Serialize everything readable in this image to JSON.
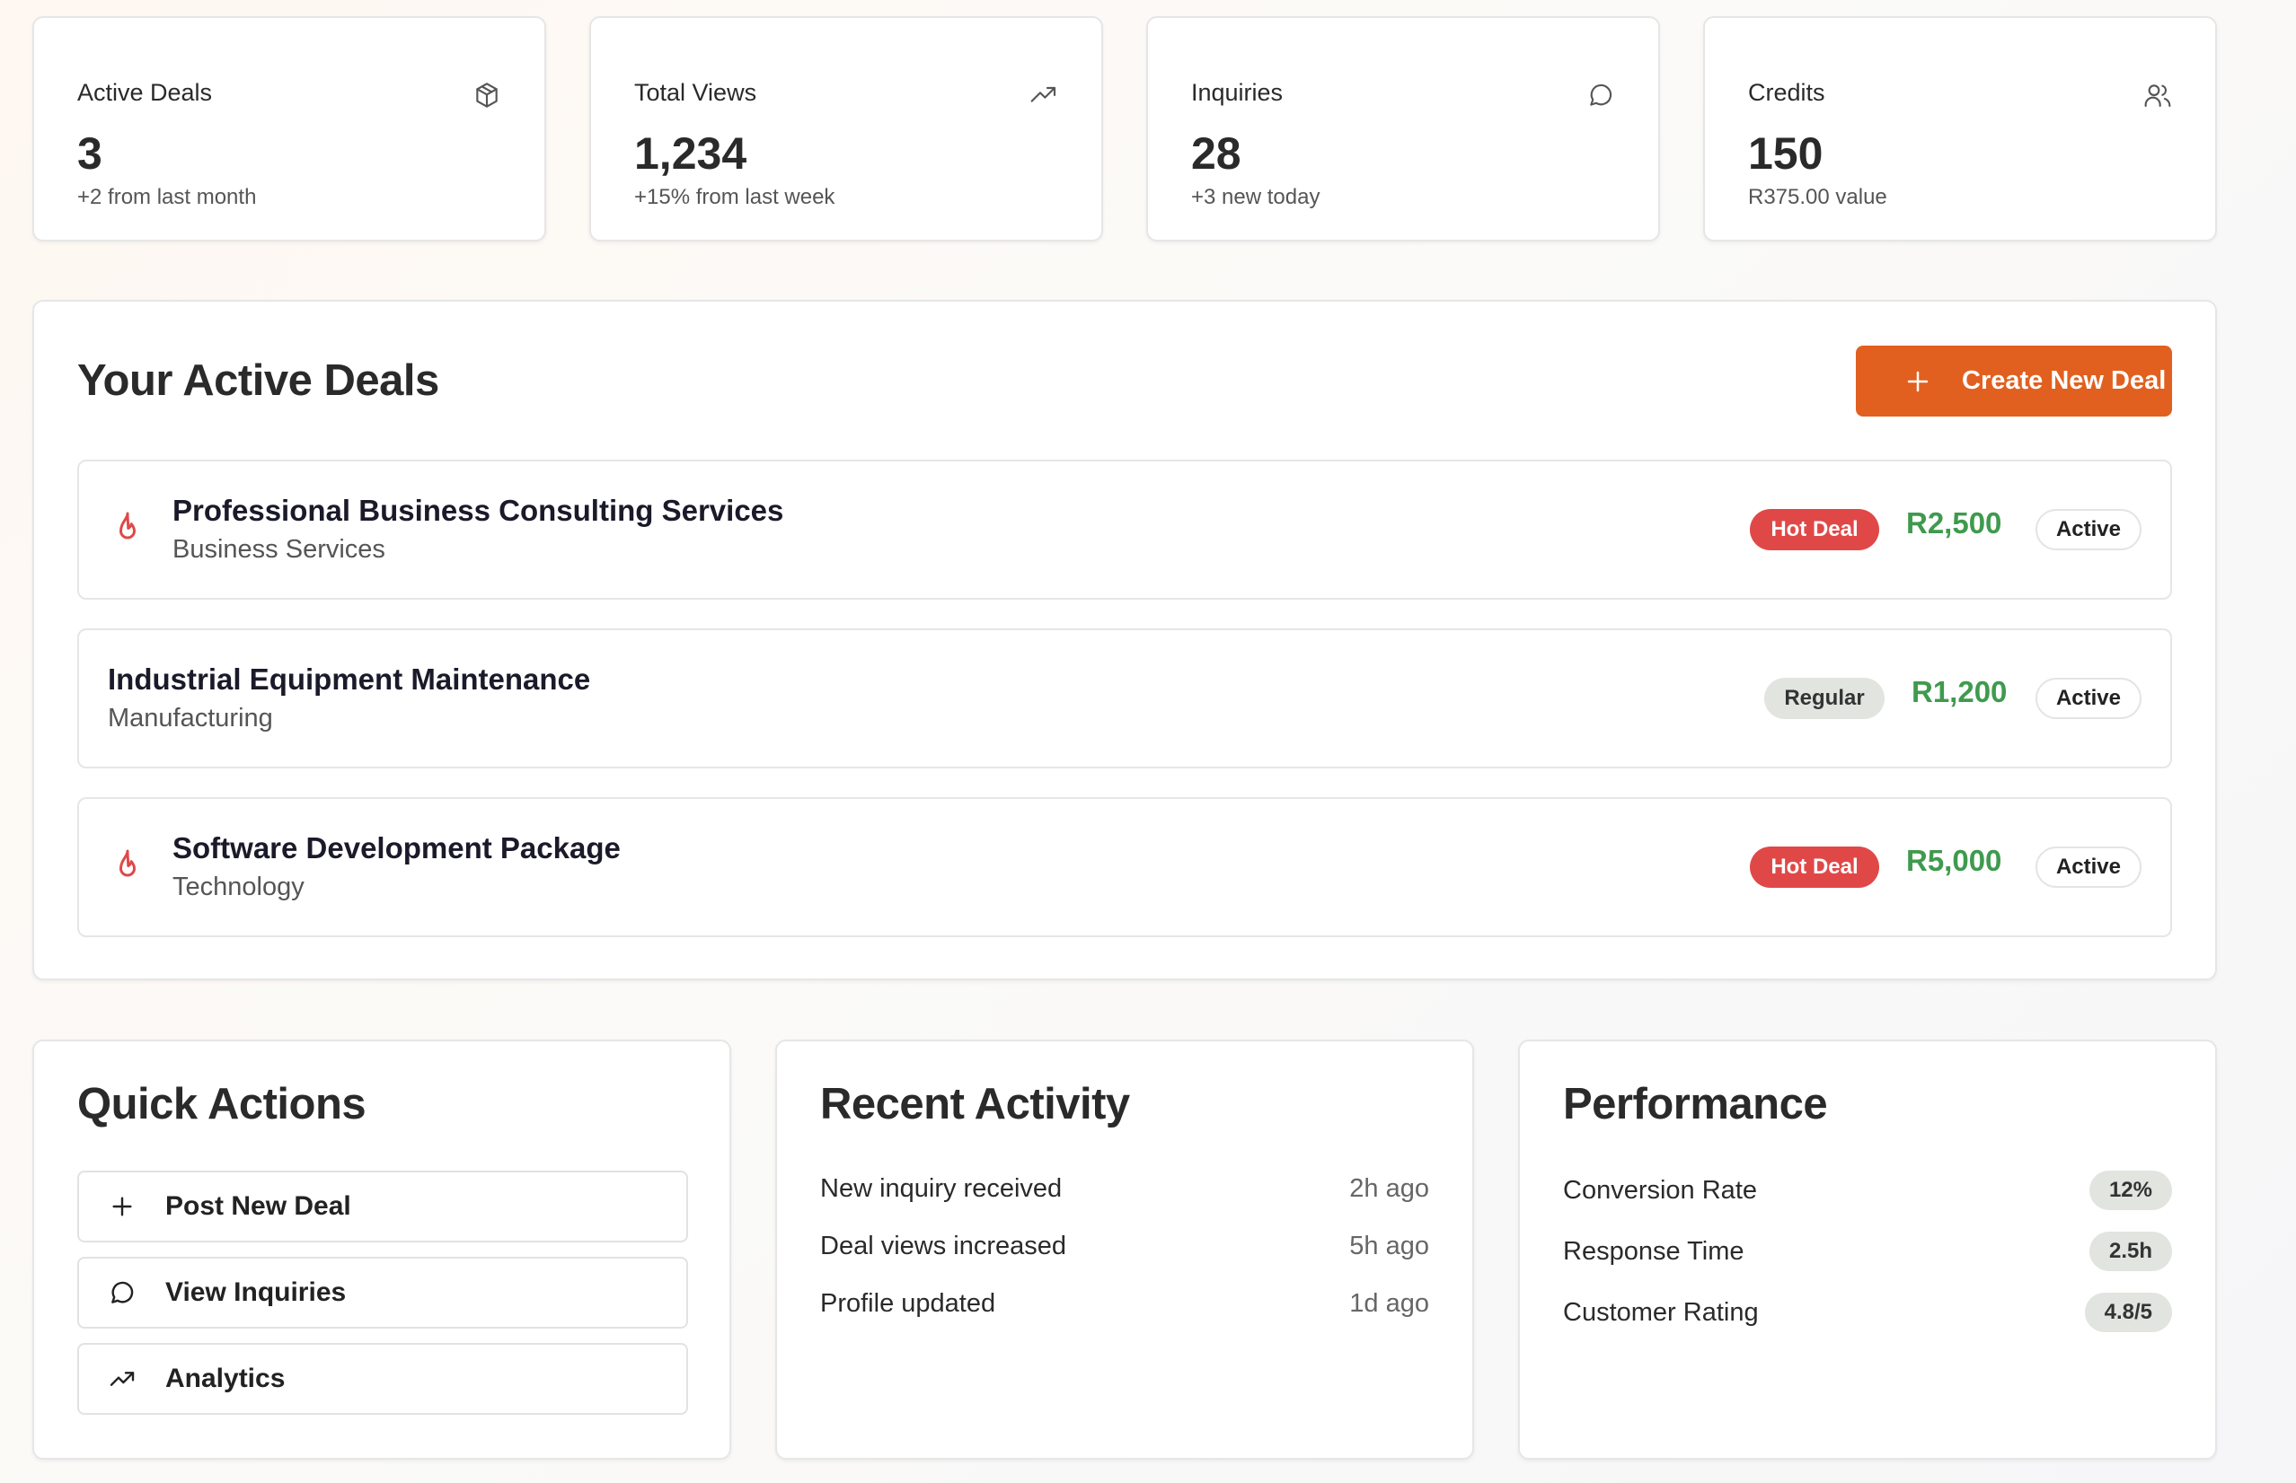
{
  "stats": [
    {
      "title": "Active Deals",
      "value": "3",
      "sub": "+2 from last month",
      "icon": "package-icon"
    },
    {
      "title": "Total Views",
      "value": "1,234",
      "sub": "+15% from last week",
      "icon": "trending-up-icon"
    },
    {
      "title": "Inquiries",
      "value": "28",
      "sub": "+3 new today",
      "icon": "message-icon"
    },
    {
      "title": "Credits",
      "value": "150",
      "sub": "R375.00 value",
      "icon": "users-icon"
    }
  ],
  "active_deals": {
    "title": "Your Active Deals",
    "create_label": "Create New Deal",
    "deals": [
      {
        "title": "Professional Business Consulting Services",
        "category": "Business Services",
        "badge": "Hot Deal",
        "price": "R2,500",
        "status": "Active",
        "hot": true
      },
      {
        "title": "Industrial Equipment Maintenance",
        "category": "Manufacturing",
        "badge": "Regular",
        "price": "R1,200",
        "status": "Active",
        "hot": false
      },
      {
        "title": "Software Development Package",
        "category": "Technology",
        "badge": "Hot Deal",
        "price": "R5,000",
        "status": "Active",
        "hot": true
      }
    ]
  },
  "quick_actions": {
    "title": "Quick Actions",
    "items": [
      {
        "label": "Post New Deal",
        "icon": "plus-icon"
      },
      {
        "label": "View Inquiries",
        "icon": "message-icon"
      },
      {
        "label": "Analytics",
        "icon": "trending-up-icon"
      }
    ]
  },
  "recent_activity": {
    "title": "Recent Activity",
    "items": [
      {
        "text": "New inquiry received",
        "time": "2h ago"
      },
      {
        "text": "Deal views increased",
        "time": "5h ago"
      },
      {
        "text": "Profile updated",
        "time": "1d ago"
      }
    ]
  },
  "performance": {
    "title": "Performance",
    "items": [
      {
        "label": "Conversion Rate",
        "value": "12%"
      },
      {
        "label": "Response Time",
        "value": "2.5h"
      },
      {
        "label": "Customer Rating",
        "value": "4.8/5"
      }
    ]
  },
  "colors": {
    "accent": "#e1601f",
    "hot": "#e04848",
    "price": "#3f9a4e"
  }
}
